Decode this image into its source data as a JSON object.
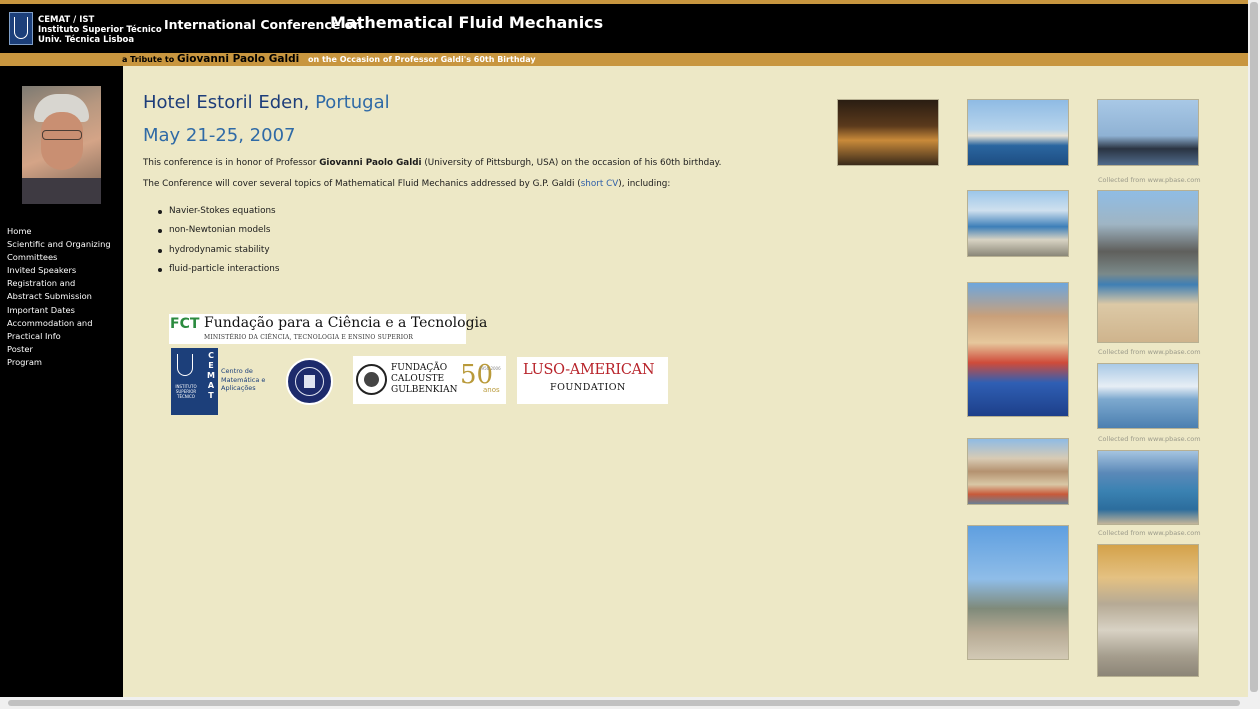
{
  "header": {
    "logo_lines": [
      "CEMAT / IST",
      "Instituto Superior Técnico",
      "Univ. Técnica Lisboa"
    ],
    "conference_prefix": "International Conference on",
    "conference_title": "Mathematical Fluid Mechanics",
    "tribute_prefix": "a Tribute to",
    "tribute_name": "Giovanni Paolo Galdi",
    "tribute_suffix": "on the Occasion of Professor Galdi's 60th Birthday"
  },
  "colors": {
    "gold_bar": "#c8963f",
    "page_bg": "#ede8c6",
    "sidebar_bg": "#000000",
    "heading_blue": "#1d3d7a",
    "accent_blue": "#2f6aa6"
  },
  "sidebar": {
    "nav": [
      "Home",
      "Scientific and Organizing",
      "Committees",
      "Invited Speakers",
      "Registration and",
      "Abstract Submission",
      "Important Dates",
      "Accommodation and",
      "Practical Info",
      "Poster",
      "Program"
    ]
  },
  "main": {
    "hotel": "Hotel Estoril Eden,",
    "country": "Portugal",
    "date": "May 21-25, 2007",
    "p1_before": "This conference is in honor of Professor",
    "p1_name": "Giovanni Paolo Galdi",
    "p1_after": "(University of Pittsburgh, USA) on the occasion of his 60th birthday.",
    "p2_before": "The Conference will cover several topics of Mathematical Fluid Mechanics addressed by G.P. Galdi (",
    "p2_link": "short CV",
    "p2_after": "), including:",
    "topics": [
      "Navier-Stokes equations",
      "non-Newtonian models",
      "hydrodynamic stability",
      "fluid-particle interactions"
    ]
  },
  "sponsors": {
    "fct_brand": "FCT",
    "fct_name": "Fundação para a Ciência e a Tecnologia",
    "fct_sub": "MINISTÉRIO DA CIÊNCIA, TECNOLOGIA E ENSINO SUPERIOR",
    "cemat_letters": "C E M A T",
    "cemat_ist": "INSTITUTO SUPERIOR TÉCNICO",
    "cemat_name_1": "Centro de",
    "cemat_name_2": "Matemática e",
    "cemat_name_3": "Aplicações",
    "gulbenkian_1": "FUNDAÇÃO",
    "gulbenkian_2": "CALOUSTE",
    "gulbenkian_3": "GULBENKIAN",
    "gulbenkian_50": "50",
    "gulbenkian_anos": "anos",
    "gulbenkian_years": "1956 2006",
    "luso_1": "LUSO-AMERICAN",
    "luso_2": "FOUNDATION"
  },
  "photos": {
    "credit": "Collected from www.pbase.com"
  }
}
